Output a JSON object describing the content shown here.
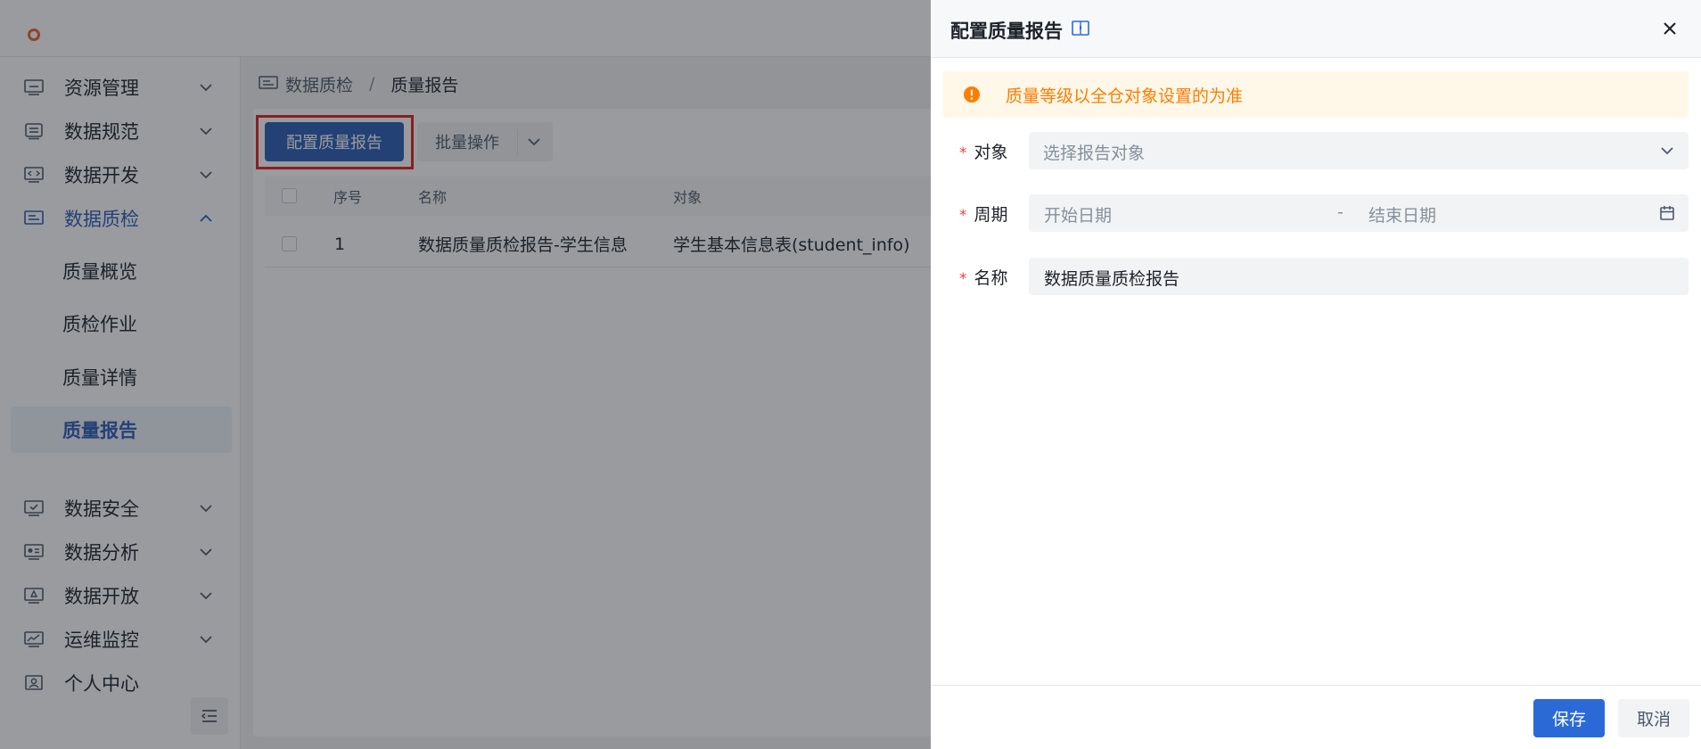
{
  "sidebar": {
    "items": [
      {
        "label": "资源管理",
        "icon": "resource-icon"
      },
      {
        "label": "数据规范",
        "icon": "standard-icon"
      },
      {
        "label": "数据开发",
        "icon": "code-icon"
      },
      {
        "label": "数据质检",
        "icon": "quality-icon",
        "expanded": true
      },
      {
        "label": "数据安全",
        "icon": "security-icon"
      },
      {
        "label": "数据分析",
        "icon": "analysis-icon"
      },
      {
        "label": "数据开放",
        "icon": "open-icon"
      },
      {
        "label": "运维监控",
        "icon": "monitor-icon"
      },
      {
        "label": "个人中心",
        "icon": "user-icon"
      }
    ],
    "subitems": [
      {
        "label": "质量概览"
      },
      {
        "label": "质检作业"
      },
      {
        "label": "质量详情"
      },
      {
        "label": "质量报告",
        "selected": true
      }
    ]
  },
  "breadcrumb": {
    "first": "数据质检",
    "separator": "/",
    "current": "质量报告"
  },
  "toolbar": {
    "config_label": "配置质量报告",
    "batch_label": "批量操作"
  },
  "table": {
    "headers": {
      "index": "序号",
      "name": "名称",
      "object": "对象"
    },
    "rows": [
      {
        "index": "1",
        "name": "数据质量质检报告-学生信息",
        "object": "学生基本信息表(student_info)"
      }
    ]
  },
  "drawer": {
    "title": "配置质量报告",
    "alert": "质量等级以全仓对象设置的为准",
    "fields": {
      "object": {
        "label": "对象",
        "placeholder": "选择报告对象"
      },
      "period": {
        "label": "周期",
        "start_placeholder": "开始日期",
        "separator": "-",
        "end_placeholder": "结束日期"
      },
      "name": {
        "label": "名称",
        "value": "数据质量质检报告"
      }
    },
    "required_mark": "*",
    "save_label": "保存",
    "cancel_label": "取消"
  },
  "colors": {
    "primary": "#2b5bb7",
    "save_button": "#2b6ad6",
    "alert_text": "#ff7d00",
    "alert_bg": "#fff7e8",
    "required": "#f53f3f",
    "highlight": "#e0201c"
  }
}
